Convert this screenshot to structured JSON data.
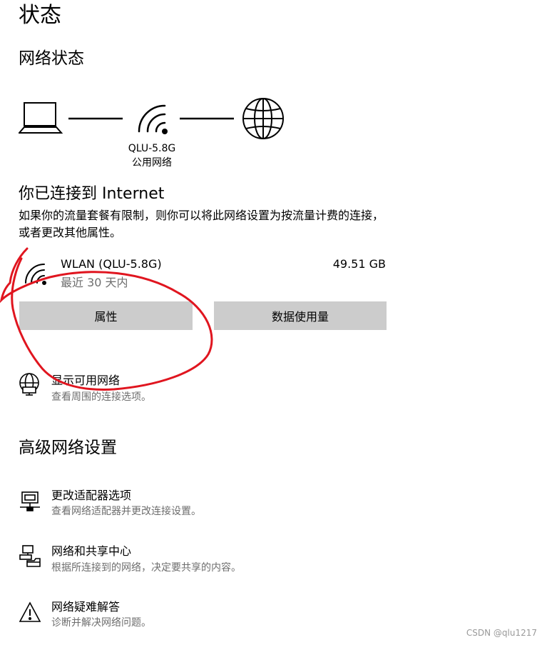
{
  "page": {
    "title": "状态"
  },
  "network_status": {
    "title": "网络状态",
    "network_name": "QLU-5.8G",
    "network_type": "公用网络"
  },
  "connection": {
    "heading": "你已连接到 Internet",
    "description": "如果你的流量套餐有限制，则你可以将此网络设置为按流量计费的连接，或者更改其他属性。",
    "adapter_name": "WLAN (QLU-5.8G)",
    "period": "最近 30 天内",
    "usage": "49.51 GB",
    "properties_button": "属性",
    "data_usage_button": "数据使用量"
  },
  "show_networks": {
    "title": "显示可用网络",
    "subtitle": "查看周围的连接选项。"
  },
  "advanced": {
    "title": "高级网络设置",
    "items": [
      {
        "title": "更改适配器选项",
        "subtitle": "查看网络适配器并更改连接设置。",
        "icon": "adapter-icon"
      },
      {
        "title": "网络和共享中心",
        "subtitle": "根据所连接到的网络，决定要共享的内容。",
        "icon": "sharing-center-icon"
      },
      {
        "title": "网络疑难解答",
        "subtitle": "诊断并解决网络问题。",
        "icon": "warning-icon"
      }
    ]
  },
  "watermark": "CSDN @qlu1217",
  "colors": {
    "button_bg": "#cccccc",
    "secondary_text": "#6e6e6e",
    "annotation_red": "#e0151f"
  }
}
